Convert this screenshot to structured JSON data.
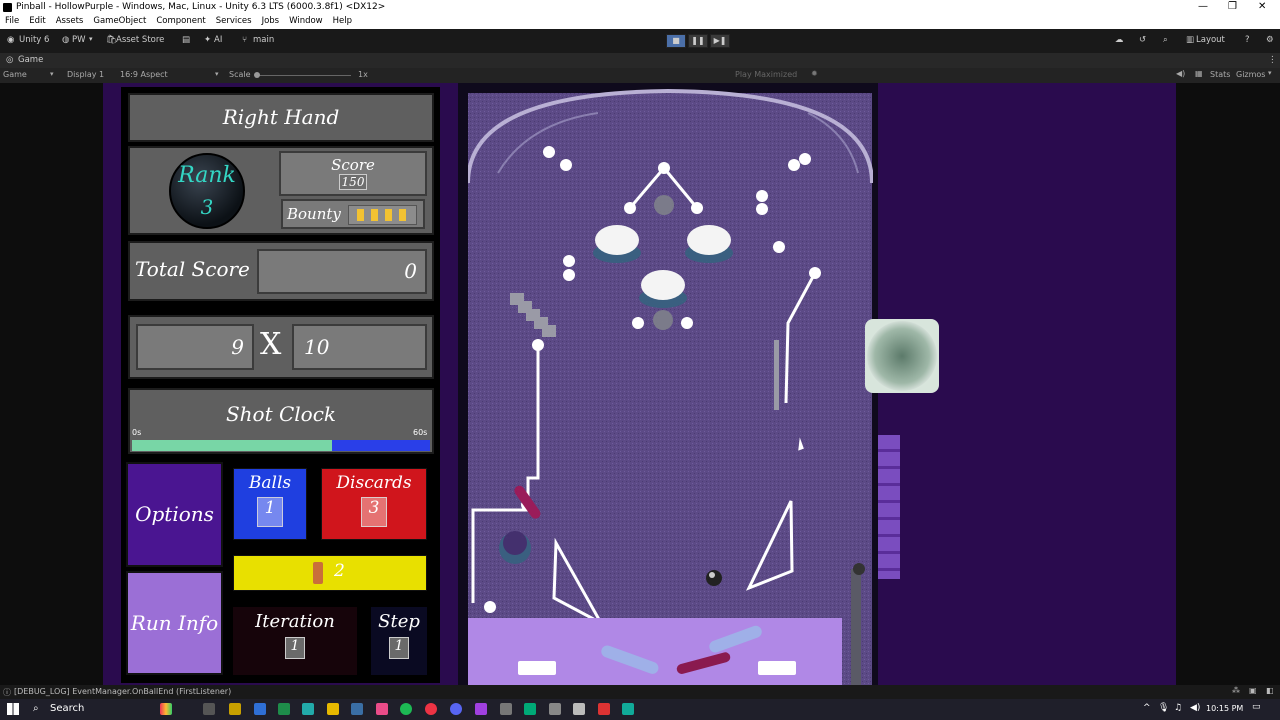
{
  "window": {
    "title": "Pinball - HollowPurple - Windows, Mac, Linux - Unity 6.3 LTS (6000.3.8f1) <DX12>"
  },
  "menu": [
    "File",
    "Edit",
    "Assets",
    "GameObject",
    "Component",
    "Services",
    "Jobs",
    "Window",
    "Help"
  ],
  "toolbar": {
    "account": "Unity 6",
    "user": "PW",
    "asset_store": "Asset Store",
    "ai": "AI",
    "branch": "main",
    "layout": "Layout"
  },
  "game_tab": {
    "label": "Game"
  },
  "game_bar": {
    "mode": "Game",
    "display": "Display 1",
    "aspect": "16:9 Aspect",
    "scale_label": "Scale",
    "scale_value": "1x",
    "play_mode": "Play Maximized",
    "stats": "Stats",
    "gizmos": "Gizmos"
  },
  "hud": {
    "hand": "Right Hand",
    "rank_label": "Rank",
    "rank_value": "3",
    "score_label": "Score",
    "score_value": "150",
    "bounty_label": "Bounty",
    "bounty_pips": 4,
    "total_label": "Total Score",
    "total_value": "0",
    "mult_a": "9",
    "mult_x": "X",
    "mult_b": "10",
    "shot_clock_label": "Shot Clock",
    "shot_min": "0s",
    "shot_max": "60s",
    "shot_progress": 0.67,
    "options": "Options",
    "balls_label": "Balls",
    "balls_value": "1",
    "discards_label": "Discards",
    "discards_value": "3",
    "yellow_value": "2",
    "run_info": "Run Info",
    "iteration_label": "Iteration",
    "iteration_value": "1",
    "step_label": "Step",
    "step_value": "1"
  },
  "colors": {
    "accent_purple": "#4a1591",
    "balls_blue": "#1f3fe0",
    "discards_red": "#d0151c",
    "yellow": "#e8e000",
    "clock_green": "#78d6a6",
    "clock_blue": "#2a3fe8",
    "runinfo": "#9b6fd6"
  },
  "status": {
    "log": "[DEBUG_LOG] EventManager.OnBallEnd (FirstListener)"
  },
  "taskbar": {
    "search": "Search",
    "time": "10:15 PM"
  }
}
